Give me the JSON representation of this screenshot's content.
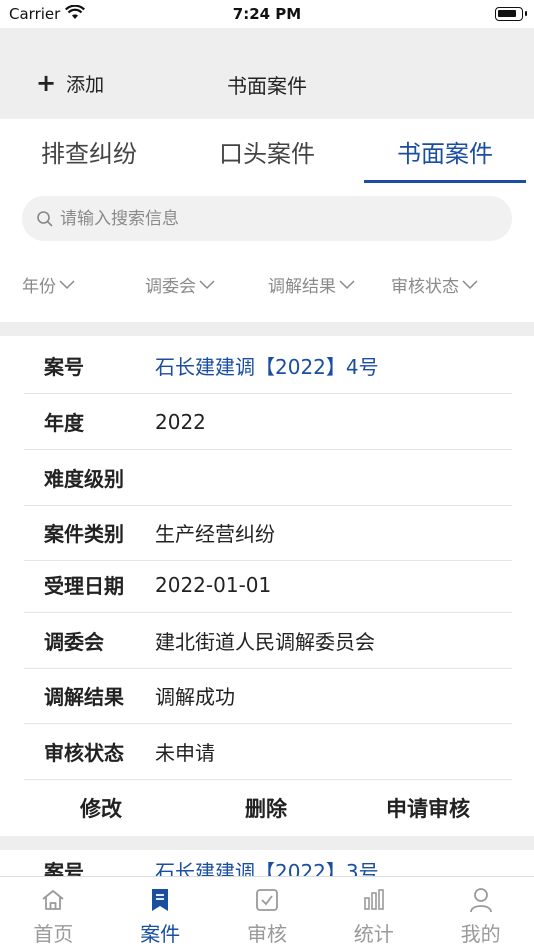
{
  "status_bar": {
    "carrier": "Carrier",
    "time": "7:24 PM"
  },
  "nav": {
    "add_label": "添加",
    "title": "书面案件"
  },
  "tabs": [
    {
      "label": "排查纠纷",
      "active": false
    },
    {
      "label": "口头案件",
      "active": false
    },
    {
      "label": "书面案件",
      "active": true
    }
  ],
  "search": {
    "placeholder": "请输入搜索信息"
  },
  "filters": [
    {
      "label": "年份"
    },
    {
      "label": "调委会"
    },
    {
      "label": "调解结果"
    },
    {
      "label": "审核状态"
    }
  ],
  "cases": [
    {
      "rows": [
        {
          "label": "案号",
          "value": "石长建建调【2022】4号"
        },
        {
          "label": "年度",
          "value": "2022"
        },
        {
          "label": "难度级别",
          "value": ""
        },
        {
          "label": "案件类别",
          "value": "生产经营纠纷"
        },
        {
          "label": "受理日期",
          "value": "2022-01-01"
        },
        {
          "label": "调委会",
          "value": "建北街道人民调解委员会"
        },
        {
          "label": "调解结果",
          "value": "调解成功"
        },
        {
          "label": "审核状态",
          "value": "未申请"
        }
      ],
      "actions": {
        "edit": "修改",
        "delete": "删除",
        "submit": "申请审核"
      }
    },
    {
      "rows": [
        {
          "label": "案号",
          "value": "石长建建调【2022】3号"
        }
      ]
    }
  ],
  "tabbar": [
    {
      "label": "首页",
      "icon": "home-icon",
      "active": false
    },
    {
      "label": "案件",
      "icon": "bookmark-icon",
      "active": true
    },
    {
      "label": "审核",
      "icon": "check-square-icon",
      "active": false
    },
    {
      "label": "统计",
      "icon": "bar-chart-icon",
      "active": false
    },
    {
      "label": "我的",
      "icon": "user-icon",
      "active": false
    }
  ],
  "colors": {
    "accent": "#1a4ea0",
    "band": "#eeeeee",
    "muted": "#8a8a8a"
  }
}
